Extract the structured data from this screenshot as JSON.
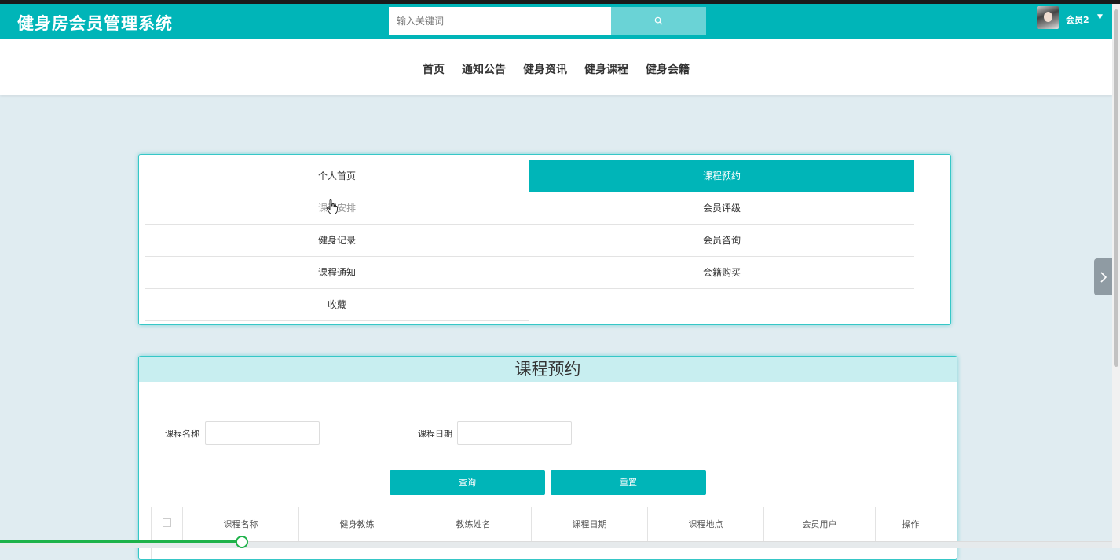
{
  "app": {
    "title": "健身房会员管理系统"
  },
  "search": {
    "placeholder": "输入关键词"
  },
  "user": {
    "name": "会员2"
  },
  "nav": {
    "items": [
      "首页",
      "通知公告",
      "健身资讯",
      "健身课程",
      "健身会籍"
    ]
  },
  "menu": {
    "items": [
      {
        "label": "个人首页",
        "state": "normal"
      },
      {
        "label": "课程预约",
        "state": "active"
      },
      {
        "label": "课程安排",
        "state": "hover"
      },
      {
        "label": "会员评级",
        "state": "normal"
      },
      {
        "label": "健身记录",
        "state": "normal"
      },
      {
        "label": "会员咨询",
        "state": "normal"
      },
      {
        "label": "课程通知",
        "state": "normal"
      },
      {
        "label": "会籍购买",
        "state": "normal"
      },
      {
        "label": "收藏",
        "state": "normal"
      }
    ]
  },
  "booking": {
    "title": "课程预约",
    "course_name_label": "课程名称",
    "course_date_label": "课程日期",
    "query_label": "查询",
    "reset_label": "重置",
    "table": {
      "headers": [
        "课程名称",
        "健身教练",
        "教练姓名",
        "课程日期",
        "课程地点",
        "会员用户",
        "操作"
      ]
    }
  },
  "colors": {
    "primary": "#00b5b8",
    "header_band": "#c8eef0",
    "page_background": "#e0ecf1"
  }
}
